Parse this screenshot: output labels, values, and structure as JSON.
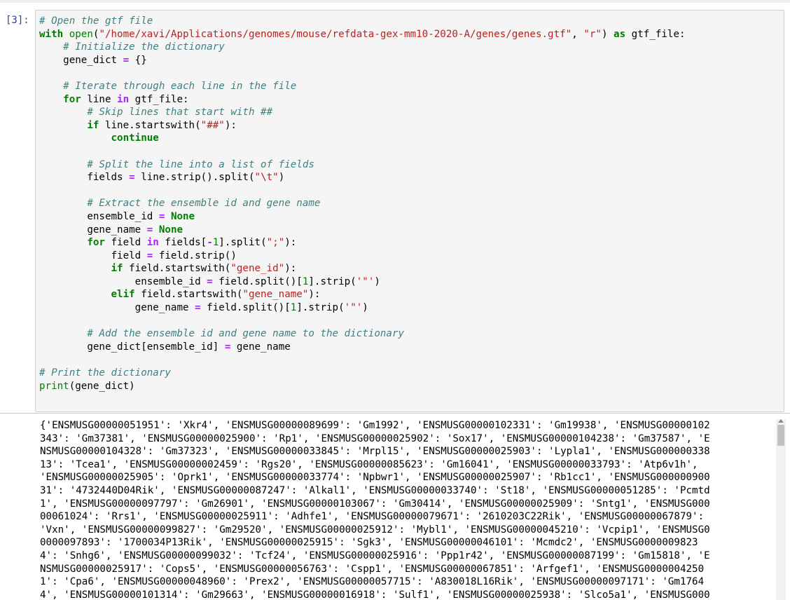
{
  "cell": {
    "prompt": "[3]:",
    "code": {
      "l01_c": "# Open the gtf file",
      "l02_kw_with": "with",
      "l02_open": "open",
      "l02_path": "\"/home/xavi/Applications/genomes/mouse/refdata-gex-mm10-2020-A/genes/genes.gtf\"",
      "l02_comma": ", ",
      "l02_mode": "\"r\"",
      "l02_close": ") ",
      "l02_kw_as": "as",
      "l02_var": " gtf_file:",
      "l03_c": "# Initialize the dictionary",
      "l04": "gene_dict ",
      "l04_eq": "=",
      "l04_rest": " {}",
      "l06_c": "# Iterate through each line in the file",
      "l07_for": "for",
      "l07_a": " line ",
      "l07_in": "in",
      "l07_b": " gtf_file:",
      "l08_c": "# Skip lines that start with ##",
      "l09_if": "if",
      "l09_a": " line.startswith(",
      "l09_s": "\"##\"",
      "l09_b": "):",
      "l10_kw": "continue",
      "l12_c": "# Split the line into a list of fields",
      "l13_a": "fields ",
      "l13_eq": "=",
      "l13_b": " line.strip().split(",
      "l13_s": "\"\\t\"",
      "l13_c2": ")",
      "l15_c": "# Extract the ensemble id and gene name",
      "l16_a": "ensemble_id ",
      "l16_eq": "=",
      "l16_none": "None",
      "l17_a": "gene_name ",
      "l17_eq": "=",
      "l17_none": "None",
      "l18_for": "for",
      "l18_a": " field ",
      "l18_in": "in",
      "l18_b": " fields[",
      "l18_minus": "-",
      "l18_one": "1",
      "l18_c2": "].split(",
      "l18_s": "\";\"",
      "l18_d": "):",
      "l19_a": "field ",
      "l19_eq": "=",
      "l19_b": " field.strip()",
      "l20_if": "if",
      "l20_a": " field.startswith(",
      "l20_s": "\"gene_id\"",
      "l20_b": "):",
      "l21_a": "ensemble_id ",
      "l21_eq": "=",
      "l21_b": " field.split()[",
      "l21_one": "1",
      "l21_c2": "].strip(",
      "l21_s": "'\"'",
      "l21_d": ")",
      "l22_elif": "elif",
      "l22_a": " field.startswith(",
      "l22_s": "\"gene_name\"",
      "l22_b": "):",
      "l23_a": "gene_name ",
      "l23_eq": "=",
      "l23_b": " field.split()[",
      "l23_one": "1",
      "l23_c2": "].strip(",
      "l23_s": "'\"'",
      "l23_d": ")",
      "l25_c": "# Add the ensemble id and gene name to the dictionary",
      "l26_a": "gene_dict[ensemble_id] ",
      "l26_eq": "=",
      "l26_b": " gene_name",
      "l28_c": "# Print the dictionary",
      "l29_print": "print",
      "l29_b": "(gene_dict)"
    }
  },
  "output": {
    "lines": [
      "{'ENSMUSG00000051951': 'Xkr4', 'ENSMUSG00000089699': 'Gm1992', 'ENSMUSG00000102331': 'Gm19938', 'ENSMUSG00000102",
      "343': 'Gm37381', 'ENSMUSG00000025900': 'Rp1', 'ENSMUSG00000025902': 'Sox17', 'ENSMUSG00000104238': 'Gm37587', 'E",
      "NSMUSG00000104328': 'Gm37323', 'ENSMUSG00000033845': 'Mrpl15', 'ENSMUSG00000025903': 'Lypla1', 'ENSMUSG000000338",
      "13': 'Tcea1', 'ENSMUSG00000002459': 'Rgs20', 'ENSMUSG00000085623': 'Gm16041', 'ENSMUSG00000033793': 'Atp6v1h',",
      "'ENSMUSG00000025905': 'Oprk1', 'ENSMUSG00000033774': 'Npbwr1', 'ENSMUSG00000025907': 'Rb1cc1', 'ENSMUSG000000900",
      "31': '4732440D04Rik', 'ENSMUSG00000087247': 'Alkal1', 'ENSMUSG00000033740': 'St18', 'ENSMUSG00000051285': 'Pcmtd",
      "1', 'ENSMUSG00000097797': 'Gm26901', 'ENSMUSG00000103067': 'Gm30414', 'ENSMUSG00000025909': 'Sntg1', 'ENSMUSG000",
      "00061024': 'Rrs1', 'ENSMUSG00000025911': 'Adhfe1', 'ENSMUSG00000079671': '2610203C22Rik', 'ENSMUSG00000067879':",
      "'Vxn', 'ENSMUSG00000099827': 'Gm29520', 'ENSMUSG00000025912': 'Mybl1', 'ENSMUSG00000045210': 'Vcpip1', 'ENSMUSG0",
      "0000097893': '1700034P13Rik', 'ENSMUSG00000025915': 'Sgk3', 'ENSMUSG00000046101': 'Mcmdc2', 'ENSMUSG0000009823",
      "4': 'Snhg6', 'ENSMUSG00000099032': 'Tcf24', 'ENSMUSG00000025916': 'Ppp1r42', 'ENSMUSG00000087199': 'Gm15818', 'E",
      "NSMUSG00000025917': 'Cops5', 'ENSMUSG00000056763': 'Cspp1', 'ENSMUSG00000067851': 'Arfgef1', 'ENSMUSG0000004250",
      "1': 'Cpa6', 'ENSMUSG00000048960': 'Prex2', 'ENSMUSG00000057715': 'A830018L16Rik', 'ENSMUSG00000097171': 'Gm1764",
      "4', 'ENSMUSG00000101314': 'Gm29663', 'ENSMUSG00000016918': 'Sulf1', 'ENSMUSG00000025938': 'Slco5a1', 'ENSMUSG000"
    ]
  }
}
